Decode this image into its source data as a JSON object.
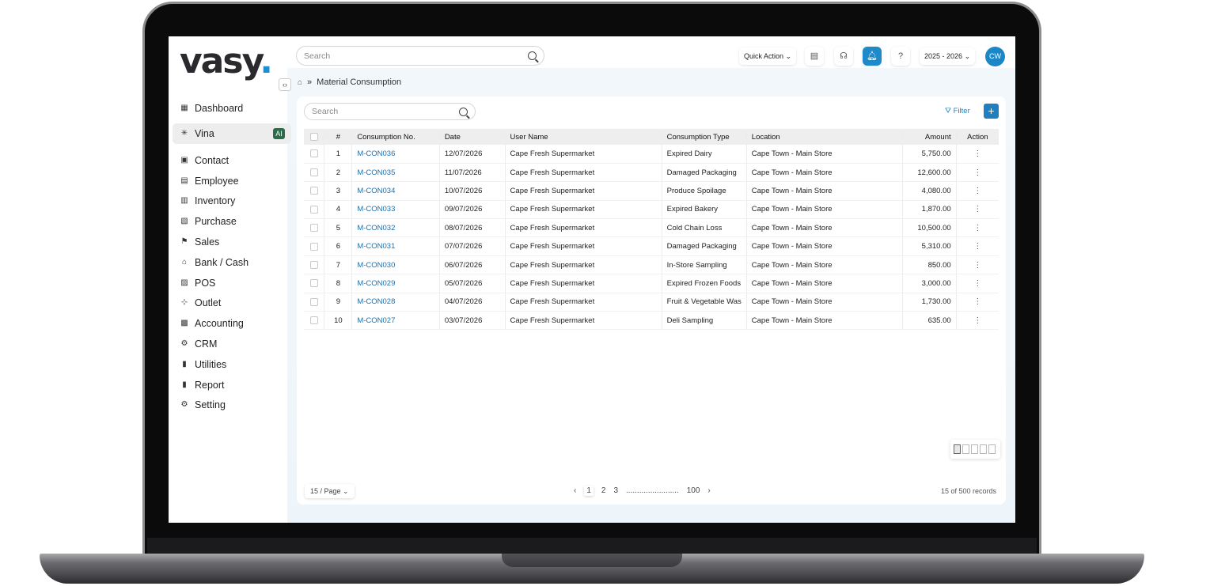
{
  "brand": {
    "logo_text": "vasy",
    "logo_dot": "."
  },
  "sidebar": {
    "items": [
      {
        "label": "Dashboard",
        "icon": "dashboard-icon"
      },
      {
        "label": "Vina",
        "icon": "sparkle-icon",
        "badge": "AI",
        "active": true
      },
      {
        "label": "Contact",
        "icon": "contact-icon"
      },
      {
        "label": "Employee",
        "icon": "employee-icon"
      },
      {
        "label": "Inventory",
        "icon": "inventory-icon"
      },
      {
        "label": "Purchase",
        "icon": "purchase-icon"
      },
      {
        "label": "Sales",
        "icon": "sales-icon"
      },
      {
        "label": "Bank / Cash",
        "icon": "bank-icon"
      },
      {
        "label": "POS",
        "icon": "pos-icon"
      },
      {
        "label": "Outlet",
        "icon": "outlet-icon"
      },
      {
        "label": "Accounting",
        "icon": "accounting-icon"
      },
      {
        "label": "CRM",
        "icon": "crm-icon"
      },
      {
        "label": "Utilities",
        "icon": "utilities-icon"
      },
      {
        "label": "Report",
        "icon": "report-icon"
      },
      {
        "label": "Setting",
        "icon": "gear-icon"
      }
    ]
  },
  "header": {
    "search_placeholder": "Search",
    "quick_action": "Quick Action",
    "year": "2025 - 2026",
    "avatar": "CW"
  },
  "breadcrumb": {
    "page": "Material Consumption"
  },
  "toolbar": {
    "search_placeholder": "Search",
    "filter_label": "Filter",
    "add_label": "+"
  },
  "table": {
    "columns": [
      "#",
      "Consumption No.",
      "Date",
      "User Name",
      "Consumption Type",
      "Location",
      "Amount",
      "Action"
    ],
    "rows": [
      {
        "n": "1",
        "no": "M-CON036",
        "date": "12/07/2026",
        "user": "Cape Fresh Supermarket",
        "type": "Expired Dairy",
        "loc": "Cape Town - Main Store",
        "amount": "5,750.00"
      },
      {
        "n": "2",
        "no": "M-CON035",
        "date": "11/07/2026",
        "user": "Cape Fresh Supermarket",
        "type": "Damaged Packaging",
        "loc": "Cape Town - Main Store",
        "amount": "12,600.00"
      },
      {
        "n": "3",
        "no": "M-CON034",
        "date": "10/07/2026",
        "user": "Cape Fresh Supermarket",
        "type": "Produce Spoilage",
        "loc": "Cape Town - Main Store",
        "amount": "4,080.00"
      },
      {
        "n": "4",
        "no": "M-CON033",
        "date": "09/07/2026",
        "user": "Cape Fresh Supermarket",
        "type": "Expired Bakery",
        "loc": "Cape Town - Main Store",
        "amount": "1,870.00"
      },
      {
        "n": "5",
        "no": "M-CON032",
        "date": "08/07/2026",
        "user": "Cape Fresh Supermarket",
        "type": "Cold Chain Loss",
        "loc": "Cape Town - Main Store",
        "amount": "10,500.00"
      },
      {
        "n": "6",
        "no": "M-CON031",
        "date": "07/07/2026",
        "user": "Cape Fresh Supermarket",
        "type": "Damaged Packaging",
        "loc": "Cape Town - Main Store",
        "amount": "5,310.00"
      },
      {
        "n": "7",
        "no": "M-CON030",
        "date": "06/07/2026",
        "user": "Cape Fresh Supermarket",
        "type": "In-Store Sampling",
        "loc": "Cape Town - Main Store",
        "amount": "850.00"
      },
      {
        "n": "8",
        "no": "M-CON029",
        "date": "05/07/2026",
        "user": "Cape Fresh Supermarket",
        "type": "Expired Frozen Foods",
        "loc": "Cape Town - Main Store",
        "amount": "3,000.00"
      },
      {
        "n": "9",
        "no": "M-CON028",
        "date": "04/07/2026",
        "user": "Cape Fresh Supermarket",
        "type": "Fruit & Vegetable Was",
        "loc": "Cape Town - Main Store",
        "amount": "1,730.00"
      },
      {
        "n": "10",
        "no": "M-CON027",
        "date": "03/07/2026",
        "user": "Cape Fresh Supermarket",
        "type": "Deli Sampling",
        "loc": "Cape Town - Main Store",
        "amount": "635.00"
      }
    ]
  },
  "footer": {
    "per_page": "15 / Page",
    "pages": [
      "1",
      "2",
      "3"
    ],
    "ellipsis": "........................",
    "last_page": "100",
    "records": "15 of 500 records"
  },
  "colors": {
    "accent": "#1f7fbf",
    "avatar": "#1b87c7",
    "ai_badge": "#2f6b4a"
  }
}
